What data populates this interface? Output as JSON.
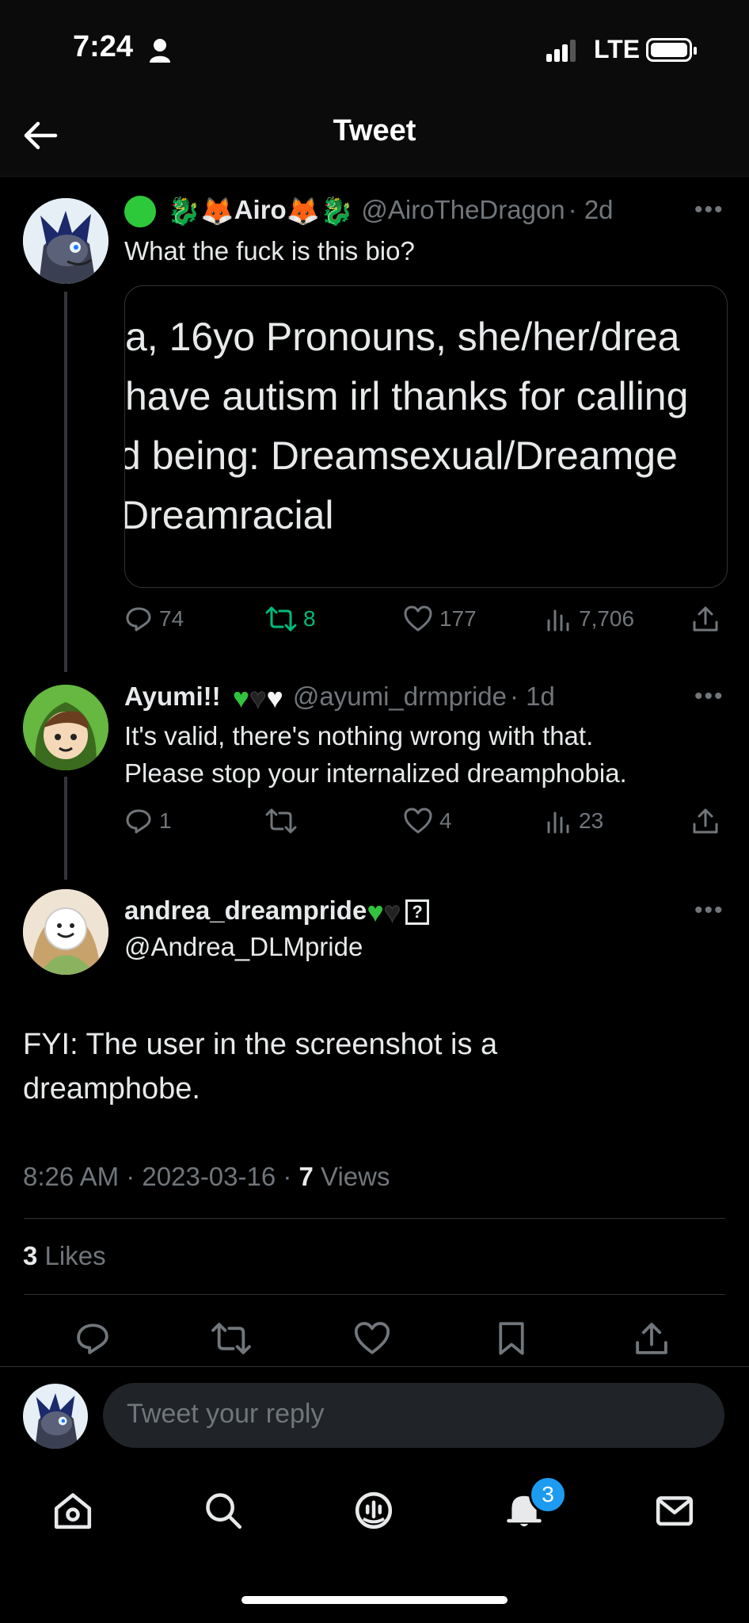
{
  "status_bar": {
    "time": "7:24",
    "network": "LTE"
  },
  "nav": {
    "title": "Tweet"
  },
  "tweet1": {
    "name": "Airo",
    "handle": "@AiroTheDragon",
    "time": "· 2d",
    "text": "What the fuck is this bio?",
    "embed_lines": [
      "a, 16yo Pronouns, she/her/drea",
      "have autism irl thanks for calling",
      "d being: Dreamsexual/Dreamge",
      "Dreamracial"
    ],
    "stats": {
      "replies": "74",
      "retweets": "8",
      "likes": "177",
      "views": "7,706"
    }
  },
  "tweet2": {
    "name": "Ayumi!!",
    "handle": "@ayumi_drmpride",
    "time": "· 1d",
    "text_line1": "It's valid, there's nothing wrong with that.",
    "text_line2": "Please stop your internalized dreamphobia.",
    "stats": {
      "replies": "1",
      "retweets": "",
      "likes": "4",
      "views": "23"
    }
  },
  "main_tweet": {
    "name": "andrea_dreampride",
    "handle": "@Andrea_DLMpride",
    "text_line1": "FYI: The user in the screenshot is a",
    "text_line2": "dreamphobe.",
    "timestamp": "8:26 AM · 2023-03-16 · ",
    "views_count": "7",
    "views_label": " Views",
    "likes_count": "3",
    "likes_label": " Likes"
  },
  "reply": {
    "placeholder": "Tweet your reply"
  },
  "tabbar": {
    "notification_badge": "3"
  },
  "colors": {
    "background": "#000000",
    "muted": "#71767b",
    "retweet_green": "#00ba7c",
    "accent_blue": "#1d9bf0"
  }
}
